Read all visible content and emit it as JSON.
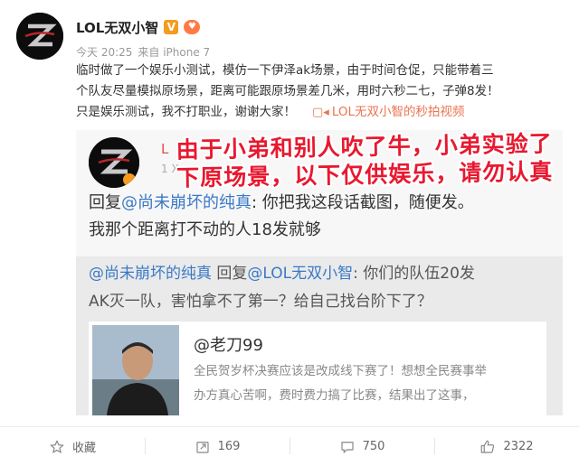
{
  "author": {
    "name": "LOL无双小智",
    "verified_badge": "V",
    "fan_badge": "♥"
  },
  "meta": {
    "time": "今天 20:25",
    "source": "来自 iPhone 7"
  },
  "post": {
    "line1": "临时做了一个娱乐小测试，模仿一下伊泽ak场景，由于时间仓促，只能带着三",
    "line2": "个队友尽量模拟原场景，距离可能跟原场景差几米，用时六秒二七，子弹8发！",
    "line3": "只是娱乐测试，我不打职业，谢谢大家！",
    "video_link": "LOL无双小智的秒拍视频"
  },
  "screenshot": {
    "overlay_line1": "由于小弟和别人吹了牛，小弟实验了",
    "overlay_line2": "下原场景，以下仅供娱乐，请勿认真",
    "author_partial": "L",
    "meta_partial": "1            X",
    "reply_prefix": "回复",
    "reply_mention": "@尚未崩坏的纯真",
    "reply_text": ": 你把我这段话截图，随便发。",
    "reply_line2": "我那个距离打不动的人18发就够",
    "quote_mention": "@尚未崩坏的纯真",
    "quote_mid": " 回复",
    "quote_mention2": "@LOL无双小智",
    "quote_text": ": 你们的队伍20发",
    "quote_line2": "AK灭一队，害怕拿不了第一？给自己找台阶下了？",
    "card_name": "@老刀99",
    "card_line1": "全民贺岁杯决赛应该是改成线下赛了！想想全民赛事举",
    "card_line2": "办方真心苦啊，费时费力搞了比赛，结果出了这事，"
  },
  "actions": {
    "favorite_label": "收藏",
    "repost_count": "169",
    "comment_count": "750",
    "like_count": "2322"
  },
  "colors": {
    "accent_orange": "#eb7350",
    "link_blue": "#3a79c6",
    "overlay_red": "#e8182f"
  },
  "icons": {
    "favorite": "star-icon",
    "repost": "repost-icon",
    "comment": "comment-icon",
    "like": "thumbs-up-icon",
    "video": "video-icon"
  }
}
